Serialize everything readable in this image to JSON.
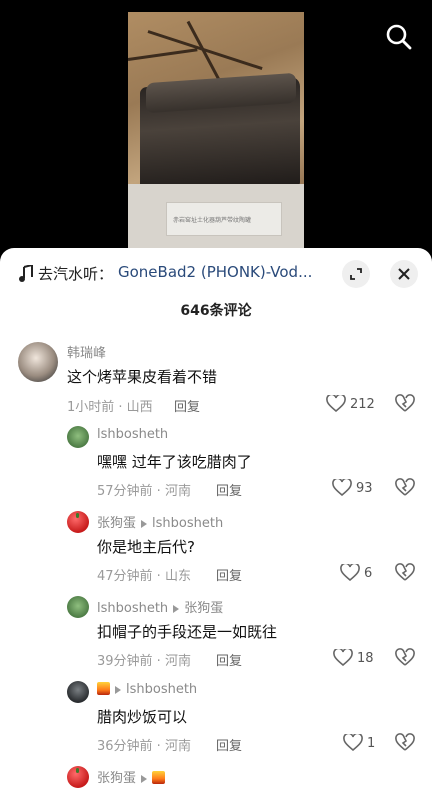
{
  "video": {
    "placard_text": "赤岩窑址土化器葫芦带纹陶罐"
  },
  "music": {
    "prefix": "去汽水听：",
    "title": "GoneBad2 (PHONK)-Vod..."
  },
  "comments_count": "646条评论",
  "comments": [
    {
      "user": "韩瑞峰",
      "text": "这个烤苹果皮看着不错",
      "time": "1小时前 · 山西",
      "reply": "回复",
      "likes": "212"
    },
    {
      "user": "lshbosheth",
      "text": "嘿嘿 过年了该吃腊肉了",
      "time": "57分钟前 · 河南",
      "reply": "回复",
      "likes": "93"
    },
    {
      "user": "张狗蛋",
      "to": "lshbosheth",
      "text": "你是地主后代?",
      "time": "47分钟前 · 山东",
      "reply": "回复",
      "likes": "6"
    },
    {
      "user": "lshbosheth",
      "to": "张狗蛋",
      "text": "扣帽子的手段还是一如既往",
      "time": "39分钟前 · 河南",
      "reply": "回复",
      "likes": "18"
    },
    {
      "user": "",
      "to": "lshbosheth",
      "text": "腊肉炒饭可以",
      "time": "36分钟前 · 河南",
      "reply": "回复",
      "likes": "1"
    },
    {
      "user": "张狗蛋",
      "to": ""
    }
  ],
  "icons": {
    "search": "search-icon",
    "music": "music-note-icon",
    "expand": "expand-icon",
    "close": "close-icon",
    "like": "heart-icon",
    "dislike": "broken-heart-icon"
  },
  "colors": {
    "music_link": "#2a4a7a",
    "meta_gray": "#9a9a9a"
  }
}
